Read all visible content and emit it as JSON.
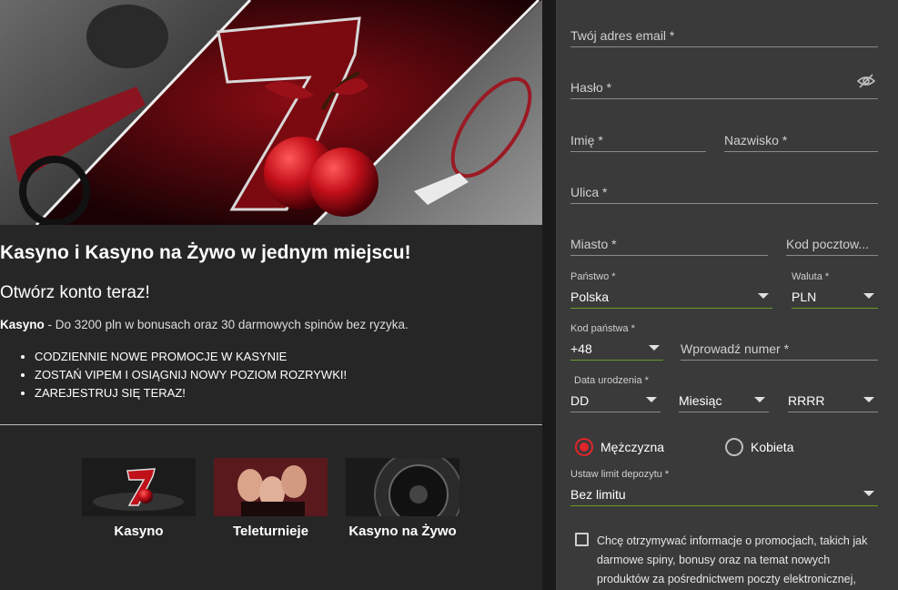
{
  "promo": {
    "title": "Kasyno i Kasyno na Żywo w jednym miejscu!",
    "subtitle": "Otwórz konto teraz!",
    "desc_bold": "Kasyno",
    "desc_rest": " - Do 3200 pln w bonusach oraz 30 darmowych spinów bez ryzyka.",
    "bullets": [
      "CODZIENNIE NOWE PROMOCJE W KASYNIE",
      "ZOSTAŃ VIPEM I OSIĄGNIJ NOWY POZIOM ROZRYWKI!",
      "ZAREJESTRUJ SIĘ TERAZ!"
    ]
  },
  "cards": [
    {
      "label": "Kasyno"
    },
    {
      "label": "Teleturnieje"
    },
    {
      "label": "Kasyno na Żywo"
    }
  ],
  "form": {
    "email_placeholder": "Twój adres email *",
    "password_placeholder": "Hasło *",
    "first_name_placeholder": "Imię *",
    "last_name_placeholder": "Nazwisko *",
    "street_placeholder": "Ulica *",
    "city_placeholder": "Miasto *",
    "postcode_placeholder": "Kod pocztow...",
    "country_label": "Państwo *",
    "country_value": "Polska",
    "currency_label": "Waluta *",
    "currency_value": "PLN",
    "dial_label": "Kod państwa *",
    "dial_value": "+48",
    "phone_placeholder": "Wprowadź numer *",
    "dob_label": "Data urodzenia *",
    "dob_day": "DD",
    "dob_month": "Miesiąc",
    "dob_year": "RRRR",
    "gender_male": "Mężczyzna",
    "gender_female": "Kobieta",
    "deposit_label": "Ustaw limit depozytu *",
    "deposit_value": "Bez limitu",
    "marketing_text": "Chcę otrzymywać informacje o promocjach, takich jak darmowe spiny, bonusy oraz na temat nowych produktów za pośrednictwem poczty elektronicznej,"
  },
  "colors": {
    "accent_red": "#e0252b",
    "valid_green": "#6a9a2a"
  }
}
